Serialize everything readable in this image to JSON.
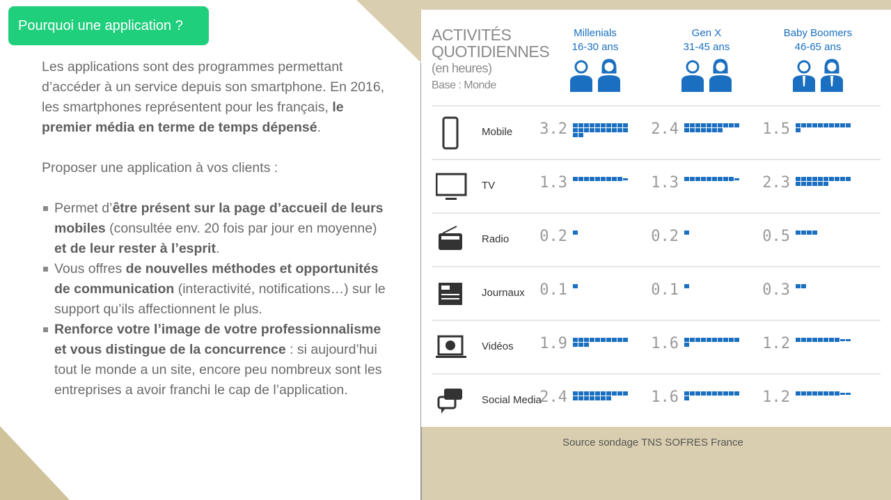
{
  "badge": "Pourquoi une application ?",
  "intro": {
    "p1_a": "Les applications sont des programmes permettant d’accéder à un service depuis son smartphone. En 2016, les smartphones représentent pour les français, ",
    "p1_b": "le premier média en terme de temps dépensé",
    "p1_c": ".",
    "p2": "Proposer une application à vos clients :"
  },
  "bullets": [
    {
      "a": "Permet d’",
      "b": "être présent sur la page d’accueil de leurs mobiles",
      "c": " (consultée env. 20 fois par jour en moyenne) ",
      "d": "et de leur rester à l’esprit",
      "e": "."
    },
    {
      "a": "Vous offres ",
      "b": "de nouvelles méthodes et opportunités de communication",
      "c": " (interactivité, notifications…) sur le support qu’ils affectionnent le plus.",
      "d": "",
      "e": ""
    },
    {
      "a": "",
      "b": "Renforce votre l’image de votre professionnalisme et vous distingue de la concurrence",
      "c": " : si aujourd’hui tout le monde a un site, encore peu nombreux sont les entreprises a avoir franchi le cap de l’application.",
      "d": "",
      "e": ""
    }
  ],
  "infographic": {
    "title1": "ACTIVITÉS",
    "title2": "QUOTIDIENNES",
    "unit": "(en heures)",
    "base": "Base : Monde",
    "accent": "#1a6fc0",
    "groups": [
      {
        "name": "Millenials",
        "age": "16-30 ans"
      },
      {
        "name": "Gen X",
        "age": "31-45 ans"
      },
      {
        "name": "Baby Boomers",
        "age": "46-65 ans"
      }
    ],
    "rows": [
      {
        "label": "Mobile",
        "icon": "mobile-icon",
        "values": [
          "3.2",
          "2.4",
          "1.5"
        ]
      },
      {
        "label": "TV",
        "icon": "tv-icon",
        "values": [
          "1.3",
          "1.3",
          "2.3"
        ]
      },
      {
        "label": "Radio",
        "icon": "radio-icon",
        "values": [
          "0.2",
          "0.2",
          "0.5"
        ]
      },
      {
        "label": "Journaux",
        "icon": "newspaper-icon",
        "values": [
          "0.1",
          "0.1",
          "0.3"
        ]
      },
      {
        "label": "Vidéos",
        "icon": "video-icon",
        "values": [
          "1.9",
          "1.6",
          "1.2"
        ]
      },
      {
        "label": "Social Media",
        "icon": "chat-icon",
        "values": [
          "2.4",
          "1.6",
          "1.2"
        ]
      }
    ]
  },
  "source": "Source sondage TNS SOFRES France"
}
